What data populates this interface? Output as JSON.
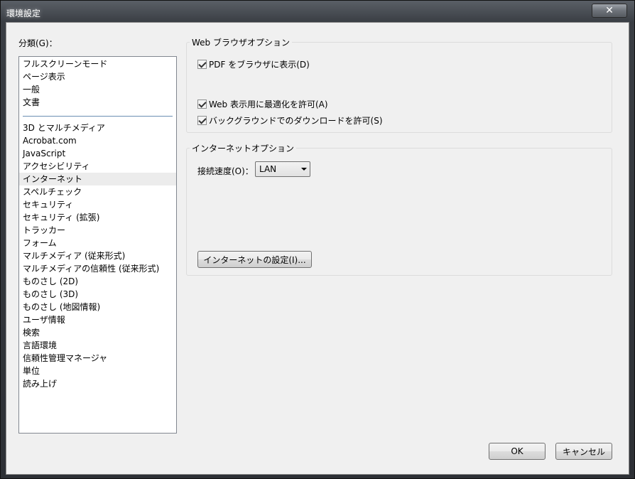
{
  "window": {
    "title": "環境設定",
    "close_label": "✕"
  },
  "category": {
    "label": "分類(G)：",
    "items_top": [
      "フルスクリーンモード",
      "ページ表示",
      "一般",
      "文書"
    ],
    "items_bottom": [
      "3D とマルチメディア",
      "Acrobat.com",
      "JavaScript",
      "アクセシビリティ",
      "インターネット",
      "スペルチェック",
      "セキュリティ",
      "セキュリティ (拡張)",
      "トラッカー",
      "フォーム",
      "マルチメディア (従来形式)",
      "マルチメディアの信頼性 (従来形式)",
      "ものさし (2D)",
      "ものさし (3D)",
      "ものさし (地図情報)",
      "ユーザ情報",
      "検索",
      "言語環境",
      "信頼性管理マネージャ",
      "単位",
      "読み上げ"
    ],
    "selected": "インターネット"
  },
  "web_browser_options": {
    "title": "Web ブラウザオプション",
    "show_pdf_in_browser": {
      "label": "PDF をブラウザに表示(D)",
      "checked": true
    },
    "allow_fast_web_view": {
      "label": "Web 表示用に最適化を許可(A)",
      "checked": true
    },
    "allow_background_download": {
      "label": "バックグラウンドでのダウンロードを許可(S)",
      "checked": true
    }
  },
  "internet_options": {
    "title": "インターネットオプション",
    "connection_speed_label": "接続速度(O)：",
    "connection_speed_value": "LAN",
    "internet_settings_button": "インターネットの設定(I)..."
  },
  "footer": {
    "ok": "OK",
    "cancel": "キャンセル"
  }
}
